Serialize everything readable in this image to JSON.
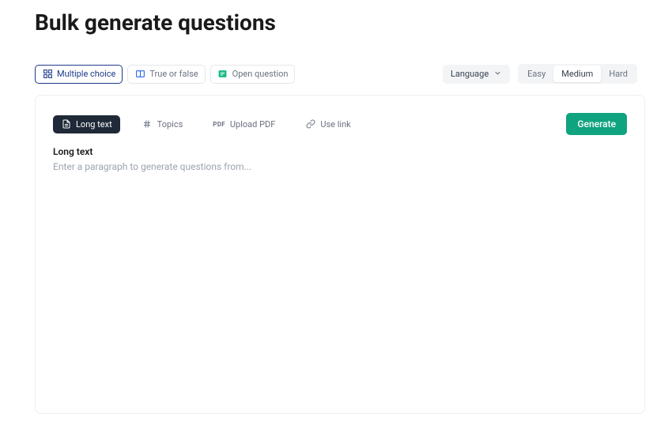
{
  "page": {
    "title": "Bulk generate questions"
  },
  "questionTypes": [
    {
      "id": "multiple-choice",
      "label": "Multiple choice",
      "active": true
    },
    {
      "id": "true-or-false",
      "label": "True or false",
      "active": false
    },
    {
      "id": "open-question",
      "label": "Open question",
      "active": false
    }
  ],
  "language": {
    "label": "Language"
  },
  "difficulty": [
    {
      "id": "easy",
      "label": "Easy",
      "active": false
    },
    {
      "id": "medium",
      "label": "Medium",
      "active": true
    },
    {
      "id": "hard",
      "label": "Hard",
      "active": false
    }
  ],
  "inputTabs": [
    {
      "id": "long-text",
      "label": "Long text",
      "active": true
    },
    {
      "id": "topics",
      "label": "Topics",
      "active": false
    },
    {
      "id": "upload-pdf",
      "label": "Upload PDF",
      "active": false
    },
    {
      "id": "use-link",
      "label": "Use link",
      "active": false
    }
  ],
  "actions": {
    "generate": "Generate"
  },
  "input": {
    "label": "Long text",
    "placeholder": "Enter a paragraph to generate questions from...",
    "value": ""
  }
}
